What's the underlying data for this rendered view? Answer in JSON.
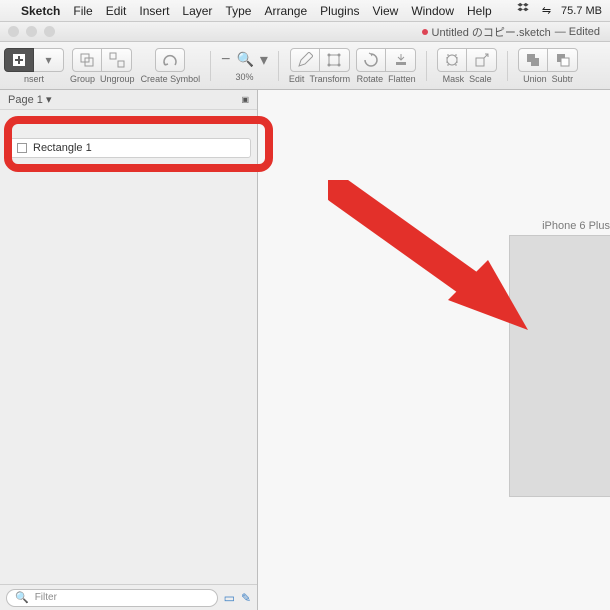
{
  "menubar": {
    "apple": "",
    "app": "Sketch",
    "items": [
      "File",
      "Edit",
      "Insert",
      "Layer",
      "Type",
      "Arrange",
      "Plugins",
      "View",
      "Window",
      "Help"
    ],
    "status": {
      "dropbox": "⇪",
      "bluetooth": "⇋",
      "memory": "75.7 MB"
    }
  },
  "window": {
    "title": "Untitled のコピー.sketch",
    "edited": "— Edited"
  },
  "toolbar": {
    "insert": "nsert",
    "group": "Group",
    "ungroup": "Ungroup",
    "createSymbol": "Create Symbol",
    "zoom": "30%",
    "edit": "Edit",
    "transform": "Transform",
    "rotate": "Rotate",
    "flatten": "Flatten",
    "mask": "Mask",
    "scale": "Scale",
    "union": "Union",
    "subtr": "Subtr"
  },
  "sidebar": {
    "pages": "Page 1",
    "layer": "Rectangle 1",
    "filterPlaceholder": "Filter"
  },
  "canvas": {
    "artboardLabel": "iPhone 6 Plus"
  }
}
